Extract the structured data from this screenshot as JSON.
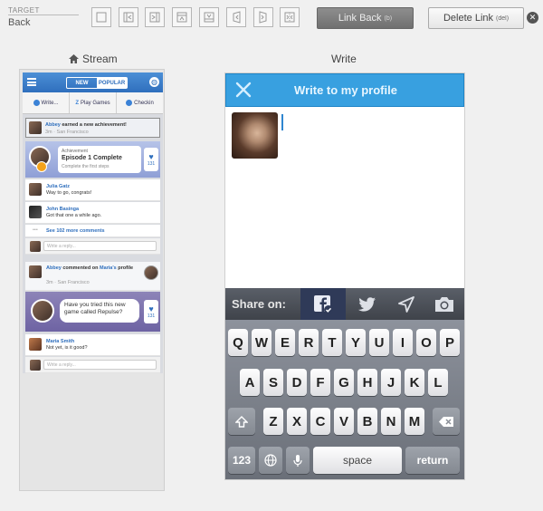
{
  "toolbar": {
    "target_label": "TARGET",
    "target_value": "Back",
    "transition_icons": [
      "none-icon",
      "slide-left-icon",
      "slide-right-icon",
      "push-up-icon",
      "push-down-icon",
      "flip-left-icon",
      "flip-right-icon",
      "dissolve-icon"
    ],
    "link_back_label": "Link Back",
    "link_back_shortcut": "(b)",
    "delete_link_label": "Delete Link",
    "delete_link_shortcut": "(del)"
  },
  "stream": {
    "title": "Stream",
    "nav": {
      "tab_new": "NEW",
      "tab_popular": "POPULAR"
    },
    "actions": [
      "Write...",
      "Play Games",
      "Checkin"
    ],
    "post1": {
      "author": "Abbey",
      "text": "earned a new achievement!",
      "meta": "3m · San Francisco",
      "achievement_kicker": "Achievement",
      "achievement_title": "Episode 1 Complete",
      "achievement_desc": "Complete the first steps",
      "likes": "131"
    },
    "comments": [
      {
        "name": "Julia Gatz",
        "text": "Way to go, congrats!"
      },
      {
        "name": "John Basinga",
        "text": "Got that one a while ago."
      }
    ],
    "more_comments": "See 102 more comments",
    "reply_placeholder": "Write a reply...",
    "post2": {
      "author": "Abbey",
      "verb": "commented on",
      "target": "Maria's",
      "target2": "profile",
      "meta": "3m · San Francisco",
      "bubble_text": "Have you tried this new game called Repulse?",
      "likes": "131"
    },
    "comment3": {
      "name": "Maria Smith",
      "text": "Not yet, is it good?"
    },
    "reply_placeholder2": "Write a reply..."
  },
  "write": {
    "title": "Write",
    "header_title": "Write to my profile",
    "share_label": "Share on:",
    "share_icons": [
      "facebook-icon",
      "twitter-icon",
      "location-icon",
      "camera-icon"
    ],
    "keyboard": {
      "row1": [
        "Q",
        "W",
        "E",
        "R",
        "T",
        "Y",
        "U",
        "I",
        "O",
        "P"
      ],
      "row2": [
        "A",
        "S",
        "D",
        "F",
        "G",
        "H",
        "J",
        "K",
        "L"
      ],
      "row3": [
        "Z",
        "X",
        "C",
        "V",
        "B",
        "N",
        "M"
      ],
      "key_123": "123",
      "key_space": "space",
      "key_return": "return"
    }
  }
}
